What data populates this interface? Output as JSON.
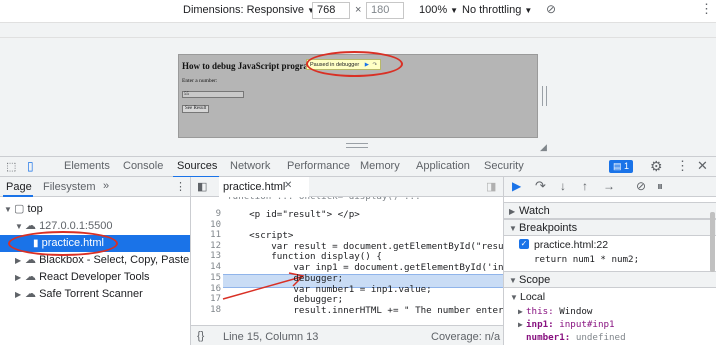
{
  "device_toolbar": {
    "dimensions_label": "Dimensions: Responsive",
    "width": "768",
    "times": "×",
    "height": "180",
    "zoom": "100%",
    "throttling": "No throttling"
  },
  "page": {
    "heading": "How to debug JavaScript program?",
    "paused_label": "Paused in debugger",
    "enter_label": "Enter a number:",
    "input_value": "55",
    "button_label": "See Result"
  },
  "devtools": {
    "tabs": [
      "Elements",
      "Console",
      "Sources",
      "Network",
      "Performance",
      "Memory",
      "Application",
      "Security"
    ],
    "active_tab": "Sources",
    "message_count": "1",
    "left": {
      "subtabs": [
        "Page",
        "Filesystem"
      ],
      "more": "»",
      "tree": [
        {
          "label": "top"
        },
        {
          "label": "127.0.0.1:5500"
        },
        {
          "label": "practice.html"
        },
        {
          "label": "Blackbox - Select, Copy, Paste & Se"
        },
        {
          "label": "React Developer Tools"
        },
        {
          "label": "Safe Torrent Scanner"
        }
      ]
    },
    "editor": {
      "file_tab": "practice.html",
      "lines": [
        {
          "n": "9",
          "t": "    <p id=\"result\"> </p>"
        },
        {
          "n": "10",
          "t": ""
        },
        {
          "n": "11",
          "t": "    <script>"
        },
        {
          "n": "12",
          "t": "        var result = document.getElementById(\"resu"
        },
        {
          "n": "13",
          "t": "        function display() {"
        },
        {
          "n": "14",
          "t": "            var inp1 = document.getElementById('in"
        },
        {
          "n": "15",
          "t": "            debugger;"
        },
        {
          "n": "16",
          "t": "            var number1 = inp1.value;"
        },
        {
          "n": "17",
          "t": "            debugger;"
        },
        {
          "n": "18",
          "t": "            result.innerHTML += \" The number enter"
        }
      ],
      "status_position": "Line 15, Column 13",
      "status_coverage": "Coverage: n/a"
    },
    "right": {
      "watch": "Watch",
      "breakpoints": "Breakpoints",
      "bp_file": "practice.html:22",
      "bp_code": "return num1 * num2;",
      "scope": "Scope",
      "local": "Local",
      "scope_rows": [
        {
          "k": "this:",
          "v": "Window"
        },
        {
          "k": "inp1:",
          "v": "input#inp1"
        },
        {
          "k": "number1:",
          "v": "undefined"
        }
      ]
    }
  }
}
